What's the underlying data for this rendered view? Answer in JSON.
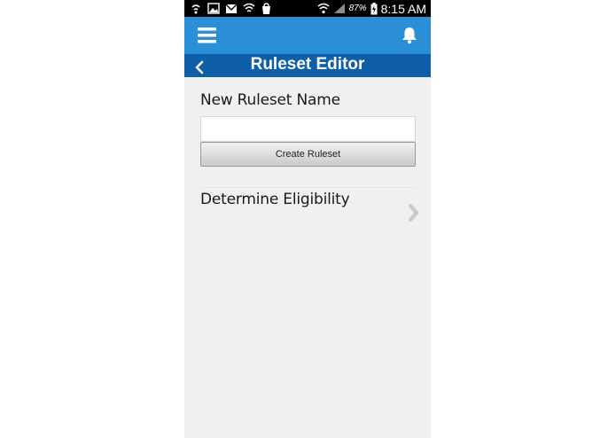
{
  "status_bar": {
    "battery_percent": "87%",
    "time": "8:15 AM",
    "icons_left": [
      "usb-icon",
      "image-icon",
      "gmail-icon",
      "wifi-icon",
      "shopping-icon"
    ],
    "icons_right": [
      "wifi-icon",
      "signal-icon",
      "battery-charging-icon"
    ]
  },
  "app_bar": {
    "menu_icon": "menu-icon",
    "notification_icon": "bell-icon"
  },
  "title_bar": {
    "title": "Ruleset Editor",
    "back_icon": "chevron-left-icon"
  },
  "form": {
    "name_label": "New Ruleset Name",
    "name_value": "",
    "create_button_label": "Create Ruleset"
  },
  "rulesets": [
    {
      "label": "Determine Eligibility"
    }
  ],
  "colors": {
    "app_bar": "#2a8fd6",
    "title_bar": "#0f5ea8",
    "background": "#eff0f2",
    "status_bar": "#000000"
  }
}
